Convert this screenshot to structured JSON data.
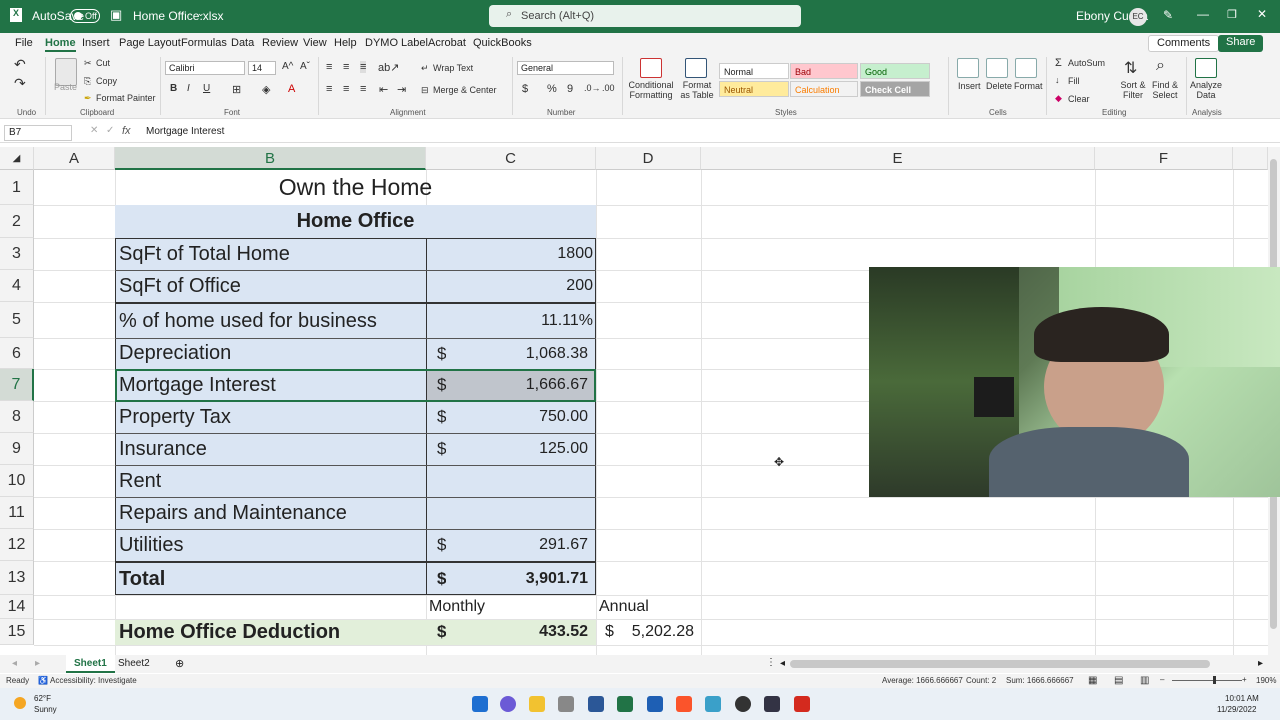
{
  "titlebar": {
    "autosave": "AutoSave",
    "autosave_state": "Off",
    "filename": "Home Office.xlsx",
    "search_placeholder": "Search (Alt+Q)",
    "user": "Ebony Cueva",
    "user_initials": "EC"
  },
  "menu": {
    "items": [
      "File",
      "Home",
      "Insert",
      "Page Layout",
      "Formulas",
      "Data",
      "Review",
      "View",
      "Help",
      "DYMO Label",
      "Acrobat",
      "QuickBooks"
    ],
    "active": "Home",
    "comments": "Comments",
    "share": "Share"
  },
  "ribbon": {
    "undo": "Undo",
    "clipboard": "Clipboard",
    "paste": "Paste",
    "cut": "Cut",
    "copy": "Copy",
    "format_painter": "Format Painter",
    "font_group": "Font",
    "font_name": "Calibri",
    "font_size": "14",
    "alignment_group": "Alignment",
    "wrap_text": "Wrap Text",
    "merge_center": "Merge & Center",
    "number_group": "Number",
    "number_format": "General",
    "conditional": "Conditional Formatting",
    "format_table": "Format as Table",
    "styles_group": "Styles",
    "styles": [
      "Normal",
      "Bad",
      "Good",
      "Neutral",
      "Calculation",
      "Check Cell"
    ],
    "cells_group": "Cells",
    "insert": "Insert",
    "delete": "Delete",
    "format": "Format",
    "editing_group": "Editing",
    "autosum": "AutoSum",
    "fill": "Fill",
    "clear": "Clear",
    "sort_filter": "Sort & Filter",
    "find_select": "Find & Select",
    "analysis_group": "Analysis",
    "analyze_data": "Analyze Data"
  },
  "formula_bar": {
    "name_box": "B7",
    "fx": "fx",
    "content": "Mortgage Interest"
  },
  "columns": [
    "A",
    "B",
    "C",
    "D",
    "E",
    "F"
  ],
  "rows": [
    "1",
    "2",
    "3",
    "4",
    "5",
    "6",
    "7",
    "8",
    "9",
    "10",
    "11",
    "12",
    "13",
    "14",
    "15"
  ],
  "sheet": {
    "title": "Own the Home",
    "subtitle": "Home Office",
    "r3": {
      "label": "SqFt of Total Home",
      "value": "1800"
    },
    "r4": {
      "label": "SqFt of Office",
      "value": "200"
    },
    "r5": {
      "label": "% of home used for business",
      "value": "11.11%"
    },
    "r6": {
      "label": "Depreciation",
      "cur": "$",
      "value": "1,068.38"
    },
    "r7": {
      "label": "Mortgage Interest",
      "cur": "$",
      "value": "1,666.67"
    },
    "r8": {
      "label": "Property Tax",
      "cur": "$",
      "value": "750.00"
    },
    "r9": {
      "label": "Insurance",
      "cur": "$",
      "value": "125.00"
    },
    "r10": {
      "label": "Rent"
    },
    "r11": {
      "label": "Repairs and Maintenance"
    },
    "r12": {
      "label": "Utilities",
      "cur": "$",
      "value": "291.67"
    },
    "r13": {
      "label": "Total",
      "cur": "$",
      "value": "3,901.71"
    },
    "r14": {
      "monthly": "Monthly",
      "annual": "Annual"
    },
    "r15": {
      "label": "Home Office Deduction",
      "cur": "$",
      "value": "433.52",
      "annual_cur": "$",
      "annual_value": "5,202.28"
    }
  },
  "tabs": {
    "sheet1": "Sheet1",
    "sheet2": "Sheet2"
  },
  "status": {
    "ready": "Ready",
    "accessibility": "Accessibility: Investigate",
    "average": "Average: 1666.666667",
    "count": "Count: 2",
    "sum": "Sum: 1666.666667",
    "zoom": "190%"
  },
  "taskbar": {
    "temp": "62°F",
    "weather": "Sunny",
    "time": "10:01 AM",
    "date": "11/29/2022"
  }
}
